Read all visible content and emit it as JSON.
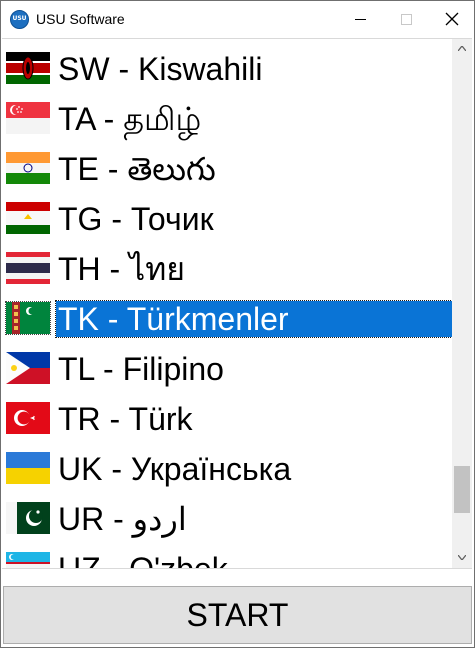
{
  "window": {
    "title": "USU Software",
    "icon_text": "USU",
    "icon": "usu-logo-icon",
    "controls": {
      "minimize": "minimize-icon",
      "maximize": "maximize-icon",
      "close": "close-icon"
    }
  },
  "languages": [
    {
      "label": "SW - Kiswahili",
      "flag": "kenya-flag-icon",
      "selected": false
    },
    {
      "label": "TA - தமிழ்",
      "flag": "singapore-flag-icon",
      "selected": false
    },
    {
      "label": "TE - తెలుగు",
      "flag": "india-flag-icon",
      "selected": false
    },
    {
      "label": "TG - Точик",
      "flag": "tajikistan-flag-icon",
      "selected": false
    },
    {
      "label": "TH - ไทย",
      "flag": "thailand-flag-icon",
      "selected": false
    },
    {
      "label": "TK - Türkmenler",
      "flag": "turkmenistan-flag-icon",
      "selected": true
    },
    {
      "label": "TL - Filipino",
      "flag": "philippines-flag-icon",
      "selected": false
    },
    {
      "label": "TR - Türk",
      "flag": "turkey-flag-icon",
      "selected": false
    },
    {
      "label": "UK - Українська",
      "flag": "ukraine-flag-icon",
      "selected": false
    },
    {
      "label": "UR - اردو",
      "flag": "pakistan-flag-icon",
      "selected": false
    },
    {
      "label": "UZ - O'zbek",
      "flag": "uzbekistan-flag-icon",
      "selected": false
    }
  ],
  "scrollbar": {
    "position_fraction": 0.9
  },
  "start_button": {
    "label": "START"
  },
  "colors": {
    "selection": "#0a74d6",
    "selection_text": "#ffffff",
    "button_face": "#e1e1e1"
  }
}
